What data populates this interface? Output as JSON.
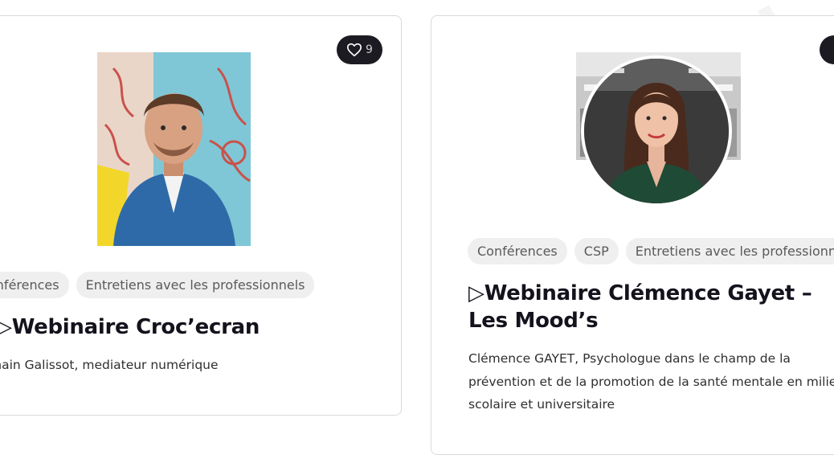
{
  "cards": [
    {
      "likes": "9",
      "tags": [
        "onférences",
        "Entretiens avec les professionnels"
      ],
      "title": "▷Webinaire Croc’ecran",
      "description": "main Galissot, mediateur numérique"
    },
    {
      "likes": "",
      "tags": [
        "Conférences",
        "CSP",
        "Entretiens avec les professionnels"
      ],
      "title": "▷Webinaire Clémence Gayet – Les Mood’s",
      "description": "Clémence GAYET, Psychologue dans le champ de la prévention et de la promotion de la santé mentale en milieu scolaire et universitaire"
    }
  ],
  "colors": {
    "like_badge": "#1d1b22",
    "tag_bg": "#efefef",
    "title_text": "#14121c",
    "card_border": "#d9d9d9"
  },
  "icons": [
    "heart-icon"
  ]
}
